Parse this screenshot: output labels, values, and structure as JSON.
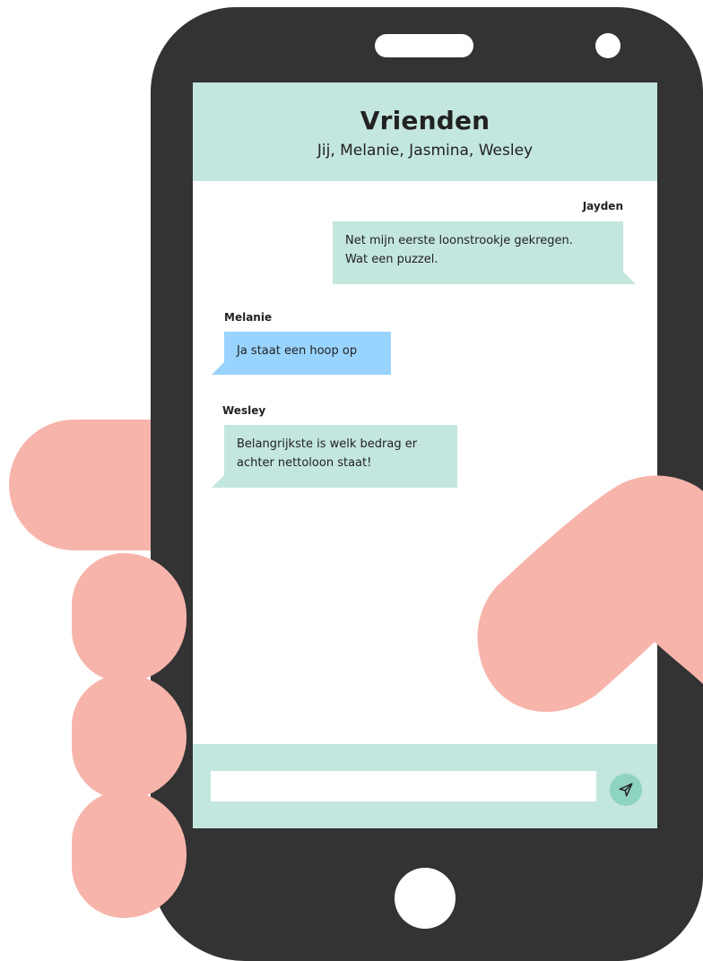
{
  "colors": {
    "phone_body": "#333333",
    "header_bg": "#c3e6de",
    "bubble_green": "#c3e6de",
    "bubble_blue": "#99d3ff",
    "send_button": "#8fd3c3",
    "hand": "#f7b4ab"
  },
  "chat": {
    "title": "Vrienden",
    "members": "Jij, Melanie, Jasmina, Wesley"
  },
  "messages": [
    {
      "sender": "Jayden",
      "lines": [
        "Net mijn eerste loonstrookje gekregen.",
        "Wat een puzzel."
      ],
      "side": "right"
    },
    {
      "sender": "Melanie",
      "lines": [
        "Ja staat een hoop op"
      ],
      "side": "left"
    },
    {
      "sender": "Wesley",
      "lines": [
        "Belangrijkste is welk bedrag er",
        "achter nettoloon staat!"
      ],
      "side": "left"
    }
  ],
  "composer": {
    "value": "",
    "send_icon": "send-icon"
  }
}
